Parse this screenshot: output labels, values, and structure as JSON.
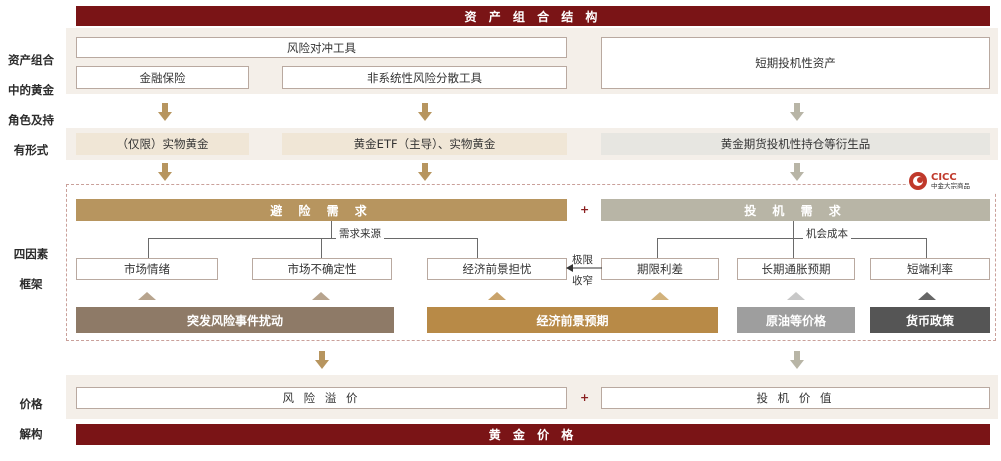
{
  "header": {
    "title": "资 产 组 合 结 构"
  },
  "left_labels": {
    "role": [
      "资产组合",
      "中的黄金",
      "角色及持",
      "有形式"
    ],
    "framework": [
      "四因素",
      "框架"
    ],
    "price": [
      "价格",
      "解构"
    ]
  },
  "portfolio": {
    "hedge": "风险对冲工具",
    "insurance": "金融保险",
    "nonsystemic": "非系统性风险分散工具",
    "speculative": "短期投机性资产"
  },
  "forms": {
    "physical_limited": "（仅限）实物黄金",
    "etf_physical": "黄金ETF（主导）、实物黄金",
    "futures": "黄金期货投机性持仓等衍生品"
  },
  "logo": {
    "brand": "CICC",
    "sub": "中金大宗商品"
  },
  "demand": {
    "hedge_title": "避 险 需 求",
    "plus": "+",
    "spec_title": "投 机 需 求",
    "source_label": "需求来源",
    "opportunity_label": "机会成本",
    "extreme_label_1": "极限",
    "extreme_label_2": "收窄"
  },
  "factors": {
    "market_sentiment": "市场情绪",
    "market_uncertainty": "市场不确定性",
    "economic_worry": "经济前景担忧",
    "term_spread": "期限利差",
    "inflation_expectation": "长期通胀预期",
    "short_rate": "短端利率"
  },
  "drivers": {
    "sudden_risk": "突发风险事件扰动",
    "economic_outlook": "经济前景预期",
    "oil_price": "原油等价格",
    "monetary_policy": "货币政策"
  },
  "price": {
    "risk_premium": "风 险 溢 价",
    "plus": "+",
    "spec_value": "投 机 价 值",
    "gold_price": "黄 金 价 格"
  },
  "colors": {
    "dark_red": "#7a1416",
    "gold": "#b7955f",
    "grey": "#b8b5a6",
    "driver_brown": "#8e7a67",
    "driver_gold": "#b88a47",
    "driver_grey": "#9e9e9e",
    "driver_dark": "#555555"
  }
}
